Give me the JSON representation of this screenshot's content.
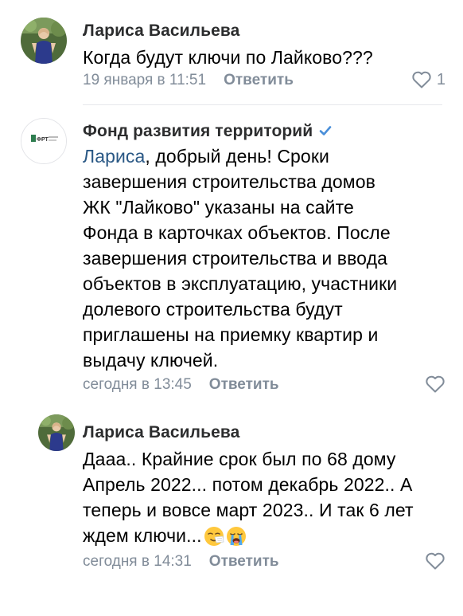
{
  "comments": [
    {
      "author": "Лариса Васильева",
      "text": "Когда будут ключи по Лайково???",
      "date": "19 января в 11:51",
      "reply_label": "Ответить",
      "likes": "1",
      "avatar": "user-photo"
    },
    {
      "author": "Фонд развития территорий",
      "verified": true,
      "mention": "Лариса",
      "text_lines": [
        ", добрый день! Сроки",
        "завершения строительства домов",
        "ЖК \"Лайково\" указаны на сайте",
        "Фонда в карточках объектов. После",
        "завершения строительства и ввода",
        "объектов в эксплуатацию, участники",
        "долевого строительства будут",
        "приглашены на приемку квартир и",
        "выдачу ключей."
      ],
      "date": "сегодня в 13:45",
      "reply_label": "Ответить",
      "avatar": "fund-logo"
    },
    {
      "author": "Лариса Васильева",
      "text_lines": [
        "Дааа.. Крайние срок был по 68 дому",
        "Апрель 2022... потом декабрь 2022.. А",
        "теперь и вовсе март 2023.. И так 6 лет",
        "ждем ключи..."
      ],
      "emojis": [
        "sneezing-face-emoji",
        "loudly-crying-face-emoji"
      ],
      "date": "сегодня в 14:31",
      "reply_label": "Ответить",
      "avatar": "user-photo"
    }
  ],
  "colors": {
    "link": "#2a5885",
    "meta": "#818c99",
    "verified": "#4a8fd9",
    "divider": "#e7e8ec"
  }
}
